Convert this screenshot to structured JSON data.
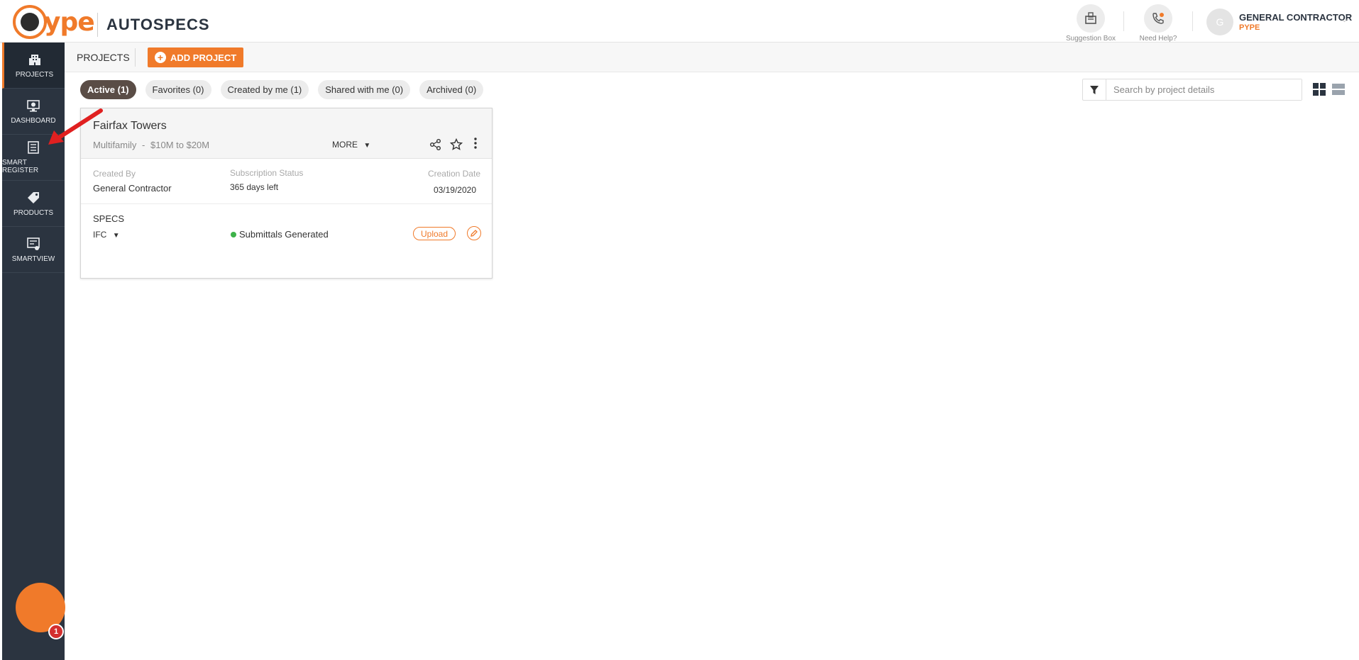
{
  "header": {
    "app_title": "AUTOSPECS",
    "logo_text": "ype",
    "suggestion_label": "Suggestion Box",
    "help_label": "Need Help?",
    "user": {
      "avatar_initial": "G",
      "name": "GENERAL CONTRACTOR",
      "org": "PYPE"
    }
  },
  "sidebar": {
    "items": [
      {
        "label": "PROJECTS",
        "icon": "building-icon",
        "active": true
      },
      {
        "label": "DASHBOARD",
        "icon": "monitor-chart-icon",
        "active": false
      },
      {
        "label": "SMART REGISTER",
        "icon": "register-list-icon",
        "active": false
      },
      {
        "label": "PRODUCTS",
        "icon": "tag-icon",
        "active": false
      },
      {
        "label": "SMARTVIEW",
        "icon": "smartview-icon",
        "active": false
      }
    ],
    "chat_badge": "1"
  },
  "toolbar": {
    "title": "PROJECTS",
    "add_button": "ADD PROJECT"
  },
  "filters": [
    {
      "label": "Active (1)",
      "active": true
    },
    {
      "label": "Favorites (0)",
      "active": false
    },
    {
      "label": "Created by me (1)",
      "active": false
    },
    {
      "label": "Shared with me (0)",
      "active": false
    },
    {
      "label": "Archived (0)",
      "active": false
    }
  ],
  "search": {
    "placeholder": "Search by project details",
    "value": ""
  },
  "project": {
    "name": "Fairfax Towers",
    "type": "Multifamily",
    "separator": "-",
    "budget": "$10M to $20M",
    "more_label": "MORE",
    "created_by_label": "Created By",
    "created_by": "General Contractor",
    "subscription_label": "Subscription Status",
    "subscription": "365 days left",
    "creation_date_label": "Creation Date",
    "creation_date": "03/19/2020",
    "specs_label": "SPECS",
    "spec_version": "IFC",
    "spec_status": "Submittals Generated",
    "upload_label": "Upload"
  },
  "colors": {
    "brand": "#f07a2a",
    "sidebar": "#2b3440",
    "active_chip": "#5a4d46",
    "status_green": "#3db249",
    "annotation_arrow": "#e02020"
  }
}
